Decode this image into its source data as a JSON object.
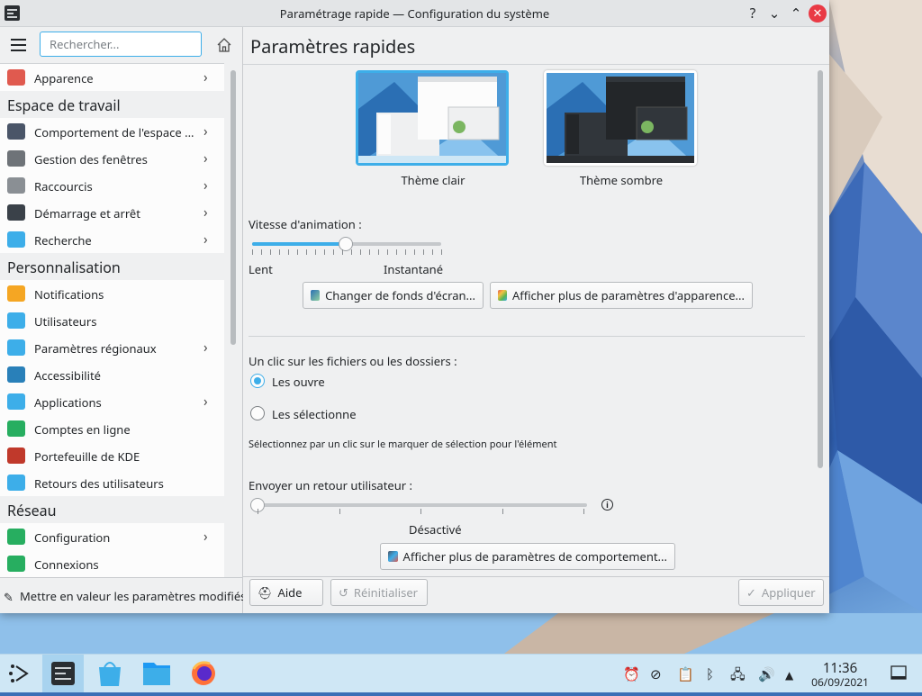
{
  "window": {
    "title": "Paramétrage rapide — Configuration du système"
  },
  "titlebar_buttons": {
    "help": "?",
    "minimize": "⌄",
    "maximize": "⌃",
    "close": "✕"
  },
  "sidebar": {
    "search_placeholder": "Rechercher...",
    "items": [
      {
        "type": "item",
        "label": "Apparence",
        "icon": "appearance-icon",
        "color": "#e05a4f",
        "chevron": true
      },
      {
        "type": "category",
        "label": "Espace de travail"
      },
      {
        "type": "item",
        "label": "Comportement de l'espace ...",
        "icon": "workspace-behavior-icon",
        "color": "#4a5568",
        "chevron": true
      },
      {
        "type": "item",
        "label": "Gestion des fenêtres",
        "icon": "window-management-icon",
        "color": "#6e7378",
        "chevron": true
      },
      {
        "type": "item",
        "label": "Raccourcis",
        "icon": "keyboard-icon",
        "color": "#8a8f94",
        "chevron": true
      },
      {
        "type": "item",
        "label": "Démarrage et arrêt",
        "icon": "startup-shutdown-icon",
        "color": "#3a4149",
        "chevron": true
      },
      {
        "type": "item",
        "label": "Recherche",
        "icon": "search-icon",
        "color": "#3daee9",
        "chevron": true
      },
      {
        "type": "category",
        "label": "Personnalisation"
      },
      {
        "type": "item",
        "label": "Notifications",
        "icon": "bell-icon",
        "color": "#f5a623",
        "chevron": false
      },
      {
        "type": "item",
        "label": "Utilisateurs",
        "icon": "users-icon",
        "color": "#3daee9",
        "chevron": false
      },
      {
        "type": "item",
        "label": "Paramètres régionaux",
        "icon": "regional-settings-icon",
        "color": "#3daee9",
        "chevron": true
      },
      {
        "type": "item",
        "label": "Accessibilité",
        "icon": "accessibility-icon",
        "color": "#2980b9",
        "chevron": false
      },
      {
        "type": "item",
        "label": "Applications",
        "icon": "applications-icon",
        "color": "#3daee9",
        "chevron": true
      },
      {
        "type": "item",
        "label": "Comptes en ligne",
        "icon": "online-accounts-icon",
        "color": "#27ae60",
        "chevron": false
      },
      {
        "type": "item",
        "label": "Portefeuille de KDE",
        "icon": "wallet-icon",
        "color": "#c0392b",
        "chevron": false
      },
      {
        "type": "item",
        "label": "Retours des utilisateurs",
        "icon": "feedback-icon",
        "color": "#3daee9",
        "chevron": false
      },
      {
        "type": "category",
        "label": "Réseau"
      },
      {
        "type": "item",
        "label": "Configuration",
        "icon": "network-config-icon",
        "color": "#27ae60",
        "chevron": true
      },
      {
        "type": "item",
        "label": "Connexions",
        "icon": "connections-icon",
        "color": "#27ae60",
        "chevron": false
      }
    ],
    "footer_label": "Mettre en valeur les paramètres modifiés"
  },
  "main": {
    "title": "Paramètres rapides",
    "themes": [
      {
        "label": "Thème clair",
        "selected": true
      },
      {
        "label": "Thème sombre",
        "selected": false
      }
    ],
    "animation": {
      "label": "Vitesse d'animation :",
      "min_label": "Lent",
      "max_label": "Instantané",
      "value_fraction": 0.5
    },
    "buttons": {
      "wallpaper": "Changer de fonds d'écran...",
      "more_appearance": "Afficher plus de paramètres d'apparence...",
      "more_behavior": "Afficher plus de paramètres de comportement..."
    },
    "click_behavior": {
      "label": "Un clic sur les fichiers ou les dossiers :",
      "options": [
        "Les ouvre",
        "Les sélectionne"
      ],
      "selected_index": 0,
      "hint": "Sélectionnez par un clic sur le marquer de sélection pour l'élément"
    },
    "feedback": {
      "label": "Envoyer un retour utilisateur :",
      "value_label": "Désactivé",
      "value_fraction": 0
    },
    "footer": {
      "help": "Aide",
      "reset": "Réinitialiser",
      "apply": "Appliquer"
    }
  },
  "taskbar": {
    "time": "11:36",
    "date": "06/09/2021"
  }
}
